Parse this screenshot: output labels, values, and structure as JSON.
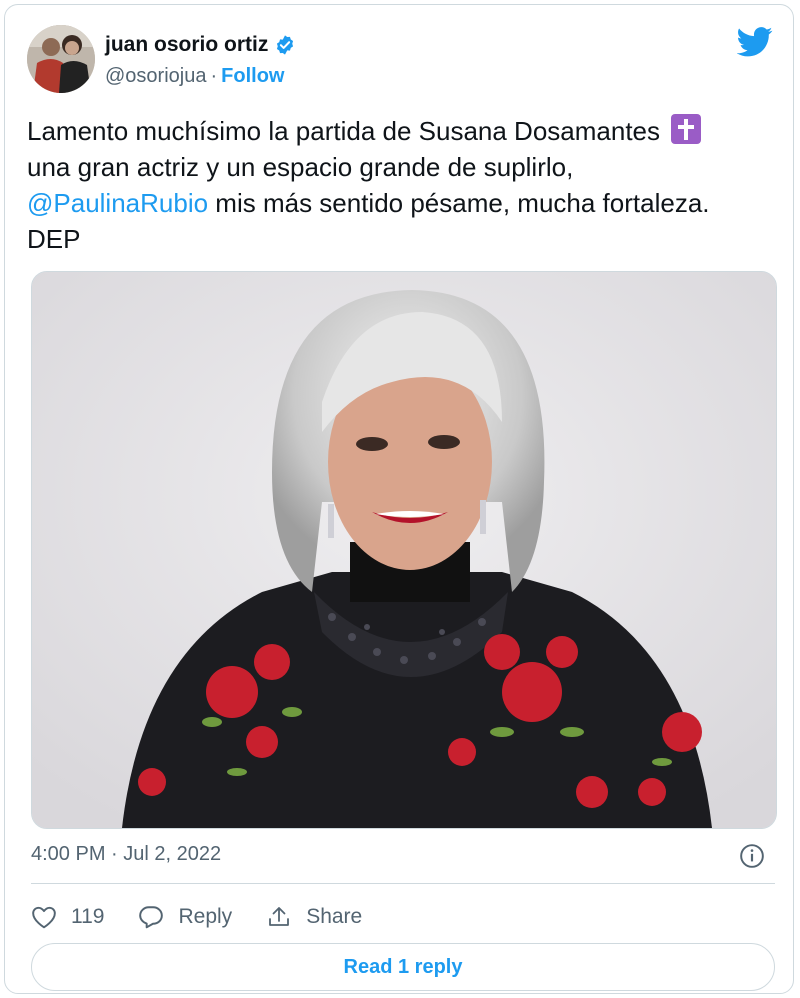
{
  "author": {
    "name": "juan osorio ortiz",
    "handle": "@osoriojua",
    "separator": "·",
    "follow_label": "Follow",
    "verified_icon": "verified-badge-icon"
  },
  "tweet": {
    "text_line1": "Lamento muchísimo la partida de Susana Dosamantes",
    "text_line2": "una gran actriz y un espacio grande de suplirlo,",
    "mention": "@PaulinaRubio",
    "text_line3_rest": " mis más sentido pésame, mucha fortaleza.",
    "text_line4": "DEP",
    "emoji": "latin-cross-emoji"
  },
  "meta": {
    "timestamp": "4:00 PM · Jul 2, 2022"
  },
  "actions": {
    "likes": "119",
    "reply_label": "Reply",
    "share_label": "Share"
  },
  "read_replies_label": "Read 1 reply",
  "colors": {
    "accent": "#1d9bf0",
    "text": "#0f1419",
    "secondary": "#536471",
    "border": "#cfd9de"
  }
}
